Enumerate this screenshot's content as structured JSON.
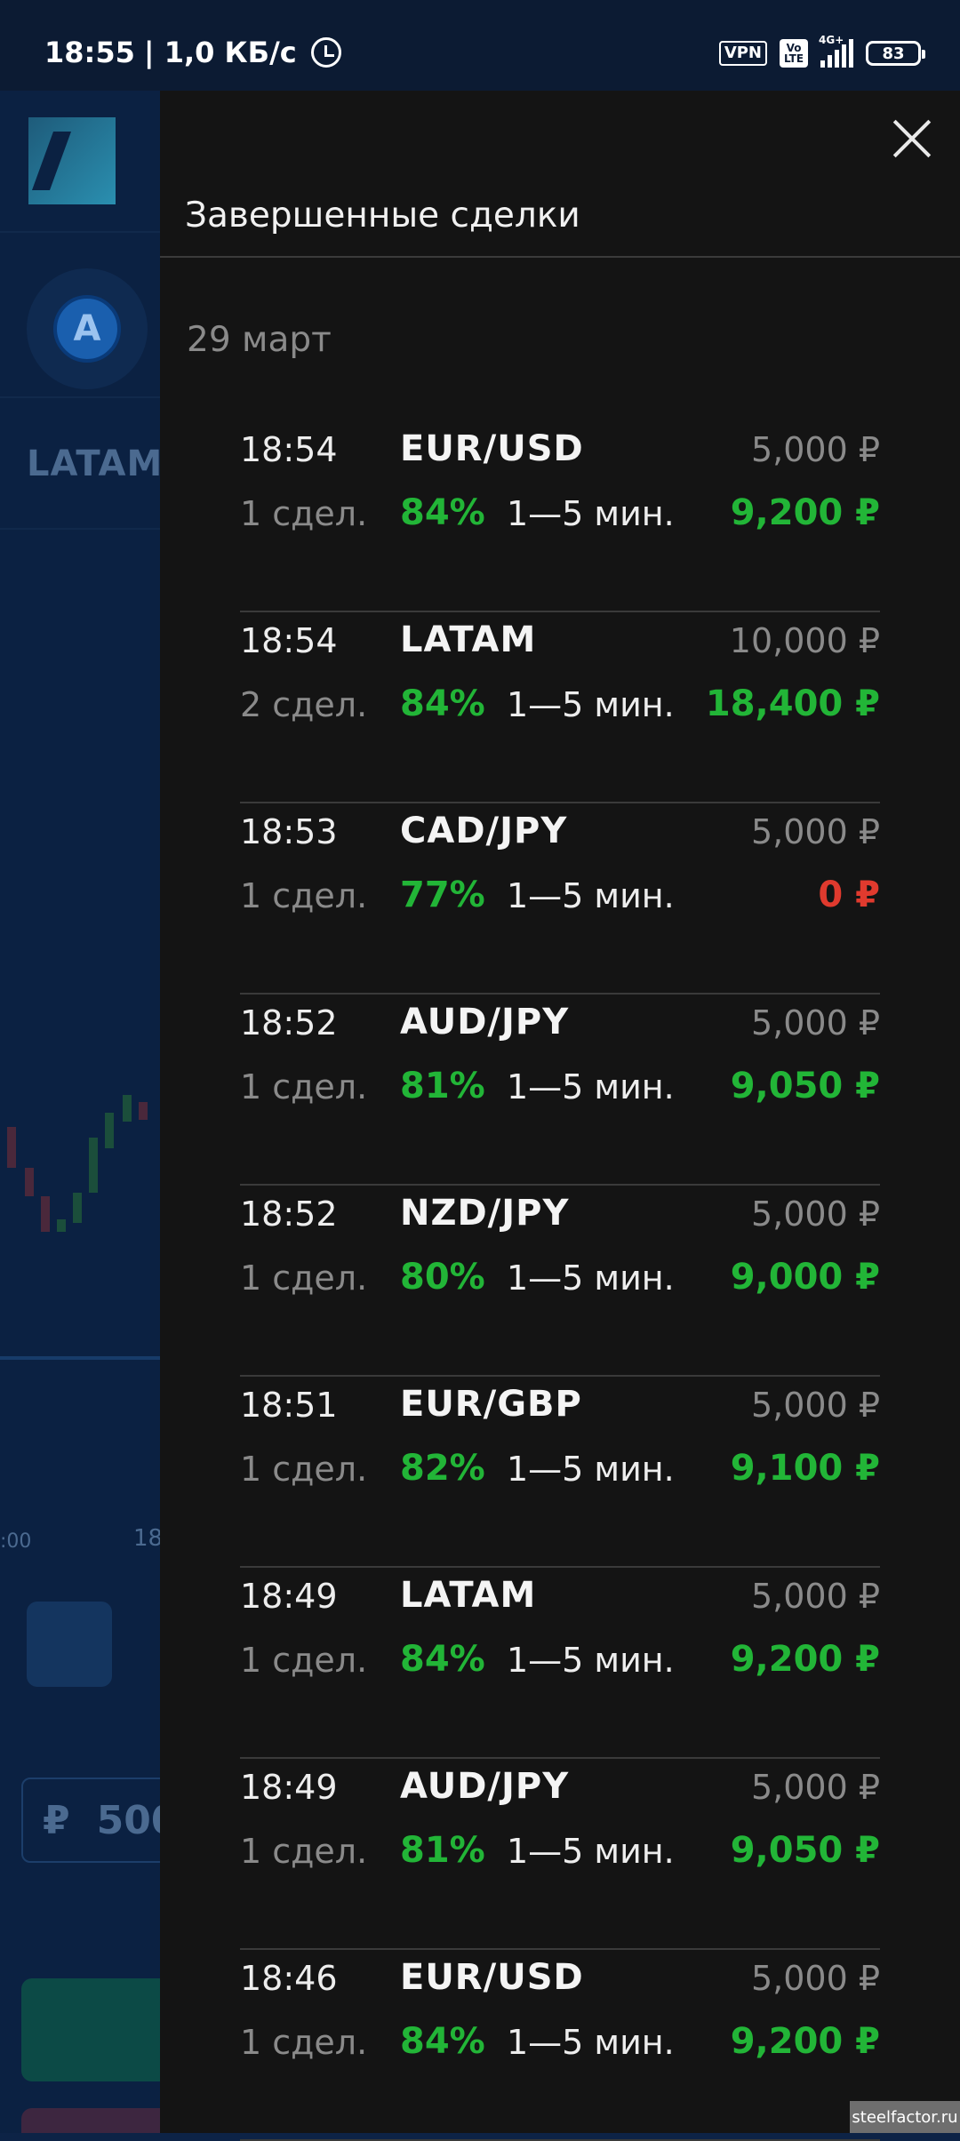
{
  "status_bar": {
    "time": "18:55",
    "speed": "| 1,0 КБ/с",
    "vpn": "VPN",
    "volte": "Vo LTE",
    "network": "4G+",
    "battery": "83"
  },
  "background_app": {
    "avatar_letter": "A",
    "asset": "LATAM",
    "time_label_1": ":00",
    "time_label_2": "18",
    "amount_currency": "₽",
    "amount_value": "500"
  },
  "drawer": {
    "title": "Завершенные сделки",
    "date": "29 март",
    "deals": [
      {
        "time": "18:54",
        "pair": "EUR/USD",
        "stake": "5,000 ₽",
        "count": "1 сдел.",
        "percent": "84%",
        "duration": "1—5 мин.",
        "payout": "9,200 ₽"
      },
      {
        "time": "18:54",
        "pair": "LATAM",
        "stake": "10,000 ₽",
        "count": "2 сдел.",
        "percent": "84%",
        "duration": "1—5 мин.",
        "payout": "18,400 ₽"
      },
      {
        "time": "18:53",
        "pair": "CAD/JPY",
        "stake": "5,000 ₽",
        "count": "1 сдел.",
        "percent": "77%",
        "duration": "1—5 мин.",
        "payout": "0 ₽"
      },
      {
        "time": "18:52",
        "pair": "AUD/JPY",
        "stake": "5,000 ₽",
        "count": "1 сдел.",
        "percent": "81%",
        "duration": "1—5 мин.",
        "payout": "9,050 ₽"
      },
      {
        "time": "18:52",
        "pair": "NZD/JPY",
        "stake": "5,000 ₽",
        "count": "1 сдел.",
        "percent": "80%",
        "duration": "1—5 мин.",
        "payout": "9,000 ₽"
      },
      {
        "time": "18:51",
        "pair": "EUR/GBP",
        "stake": "5,000 ₽",
        "count": "1 сдел.",
        "percent": "82%",
        "duration": "1—5 мин.",
        "payout": "9,100 ₽"
      },
      {
        "time": "18:49",
        "pair": "LATAM",
        "stake": "5,000 ₽",
        "count": "1 сдел.",
        "percent": "84%",
        "duration": "1—5 мин.",
        "payout": "9,200 ₽"
      },
      {
        "time": "18:49",
        "pair": "AUD/JPY",
        "stake": "5,000 ₽",
        "count": "1 сдел.",
        "percent": "81%",
        "duration": "1—5 мин.",
        "payout": "9,050 ₽"
      },
      {
        "time": "18:46",
        "pair": "EUR/USD",
        "stake": "5,000 ₽",
        "count": "1 сдел.",
        "percent": "84%",
        "duration": "1—5 мин.",
        "payout": "9,200 ₽"
      }
    ]
  },
  "colors": {
    "profit": "#22b537",
    "loss": "#e03a2e",
    "muted": "#8a8a8a"
  },
  "watermark": "steelfactor.ru"
}
